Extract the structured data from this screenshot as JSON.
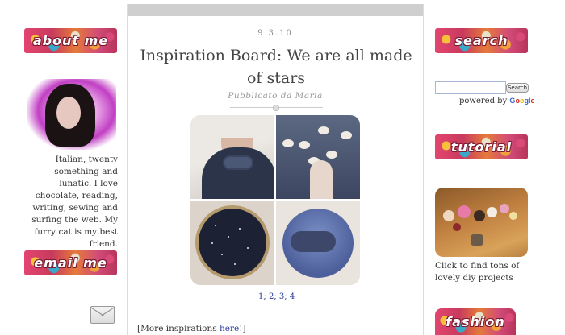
{
  "left": {
    "about_banner": "about me",
    "bio": "Italian, twenty something and lunatic. I love chocolate, reading, writing, sewing and surfing the web. My furry cat is my best friend.",
    "email_banner": "email me"
  },
  "post": {
    "date": "9.3.10",
    "title": "Inspiration Board: We are all made of stars",
    "author": "Pubblicato da Maria",
    "pages": [
      "1",
      "2",
      "3",
      "4"
    ],
    "more_prefix": "[More inspirations ",
    "more_link": "here!",
    "more_suffix": "]"
  },
  "right": {
    "search_banner": "search",
    "search_value": "",
    "search_button": "Search",
    "powered_by": "powered by",
    "google": [
      "G",
      "o",
      "o",
      "g",
      "l",
      "e"
    ],
    "tutorial_banner": "tutorial",
    "diy_caption": "Click to find tons of lovely diy projects",
    "fashion_banner": "fashion"
  },
  "icons": {
    "mail": "envelope-icon"
  }
}
